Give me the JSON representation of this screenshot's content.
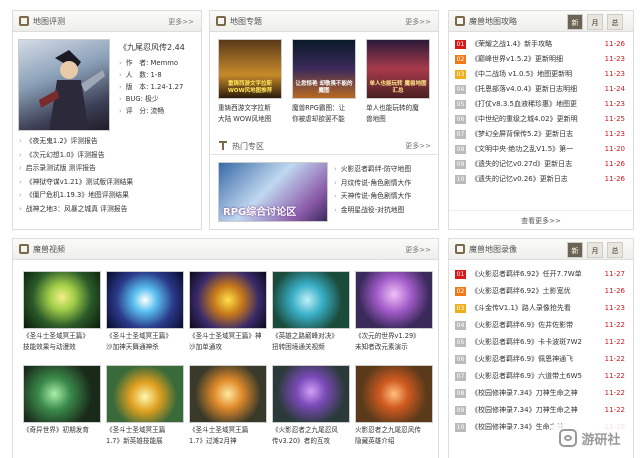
{
  "map_review": {
    "title": "地图评测",
    "more": "更多>>",
    "feature": {
      "name": "《九尾忍风传2.44",
      "rows": [
        "作　者: Memmo",
        "人　数: 1-8",
        "版　本: 1.24-1.27",
        "BUG: 极少",
        "评　分: 流畅"
      ]
    },
    "list": [
      "《夜无鬼1.2》评测报告",
      "《次元幻想1.0》评测报告",
      "启示录测试版 测评报告",
      "《神狱夺谋v1.21》测试版评测结果",
      "《僵尸危机1.19.3》地图评测结果",
      "战神之地3：风暴之城真 评测报告"
    ]
  },
  "map_topics": {
    "title": "地图专题",
    "more": "更多>>",
    "items": [
      {
        "img_text": "重铸西游文字拉斯 WOW风地图推荐",
        "caption": [
          "重铸西游文字拉斯",
          "大陆 WOW风地图"
        ]
      },
      {
        "img_text": "让您惊艳 却敬畏不能的魔图",
        "caption": [
          "魔兽RPG霸图：让",
          "你被虐却欲罢不能"
        ]
      },
      {
        "img_text": "单人也能玩转 魔兽地图汇总",
        "caption": [
          "单人也能玩转的魔",
          "兽地图"
        ]
      }
    ]
  },
  "hot_zone": {
    "title": "热门专区",
    "more": "更多>>",
    "banner": "RPG综合讨论区",
    "list": [
      "火影忍者羁绊-防守地图",
      "月纹传说-角色剧情大作",
      "天神传说-角色剧情大作",
      "金明星战役-对抗地图"
    ]
  },
  "map_ranking": {
    "title": "魔兽地图攻略",
    "tabs": [
      "新",
      "月",
      "总"
    ],
    "more": "查看更多>>",
    "rows": [
      {
        "num": "01",
        "text": "《荣耀之战1.4》新手攻略",
        "date": "11-26"
      },
      {
        "num": "02",
        "text": "《巅峰世界v1.5.2》更新明细",
        "date": "11-23"
      },
      {
        "num": "03",
        "text": "《中二战场 v1.0.5》地图更新明",
        "date": "11-23"
      },
      {
        "num": "04",
        "text": "《托恩部落v4.0.4》更新日志明细",
        "date": "11-24"
      },
      {
        "num": "05",
        "text": "《打仗v8.3.5血液稀珍惠》地图更",
        "date": "11-23"
      },
      {
        "num": "06",
        "text": "《中世纪的重级之城4.02》更新明",
        "date": "11-25"
      },
      {
        "num": "07",
        "text": "《梦幻全屏背保传5.2》更新日志",
        "date": "11-23"
      },
      {
        "num": "08",
        "text": "《文明中央·绝功之乱V1.5》第一",
        "date": "11-20"
      },
      {
        "num": "09",
        "text": "《遗失的记忆v0.27d》更新日志",
        "date": "11-26"
      },
      {
        "num": "10",
        "text": "《遗失的记忆v0.26》更新日志",
        "date": "11-26"
      }
    ]
  },
  "map_video": {
    "title": "魔兽视频",
    "more": "更多>>",
    "row1": [
      {
        "caption": [
          "《圣斗士圣域冥王篇》",
          "技能效果与动漫效"
        ]
      },
      {
        "caption": [
          "《圣斗士圣域冥王篇》",
          "沙加神天舞通神杀"
        ]
      },
      {
        "caption": [
          "《圣斗士圣域冥王篇》神",
          "沙加单通攻"
        ]
      },
      {
        "caption": [
          "《英雄之路巅峰对决》",
          "扭转困境通关视频"
        ]
      },
      {
        "caption": [
          "《次元的世界v1.29》",
          "未知者改元素演示"
        ]
      }
    ],
    "row2": [
      {
        "caption": [
          "《奇异世界》初期发育",
          ""
        ]
      },
      {
        "caption": [
          "《圣斗士圣域冥王篇",
          "1.7》新英雄技能展"
        ]
      },
      {
        "caption": [
          "《圣斗士圣域冥王篇",
          "1.7》过滩2月神"
        ]
      },
      {
        "caption": [
          "《火影忍者之九尾忍风",
          "传v3.20》者的互攻"
        ]
      },
      {
        "caption": [
          "火影忍者之九尾忍风传",
          "隐藏英雄介绍"
        ]
      }
    ]
  },
  "video_ranking": {
    "title": "魔兽地图录像",
    "tabs": [
      "新",
      "月",
      "总"
    ],
    "rows": [
      {
        "num": "01",
        "text": "《火影忍者羁绊6.92》任开7.7W单",
        "date": "11-27"
      },
      {
        "num": "02",
        "text": "《火影忍者羁绊6.92》土影宽优",
        "date": "11-26"
      },
      {
        "num": "03",
        "text": "《斗金传V1.1》路人录像抢先看",
        "date": "11-23"
      },
      {
        "num": "04",
        "text": "《火影忍者羁绊6.9》佐井佐影带",
        "date": "11-22"
      },
      {
        "num": "05",
        "text": "《火影忍者羁绊6.9》卡卡波斑7W2",
        "date": "11-22"
      },
      {
        "num": "06",
        "text": "《火影忍者羁绊6.9》佩恩神通飞",
        "date": "11-22"
      },
      {
        "num": "07",
        "text": "《火影忍者羁绊6.9》六道带土6W5",
        "date": "11-22"
      },
      {
        "num": "08",
        "text": "《校园修神录7.34》刀神生命之神",
        "date": "11-22"
      },
      {
        "num": "09",
        "text": "《校园修神录7.34》刀神生命之神",
        "date": "11-22"
      },
      {
        "num": "10",
        "text": "《校园修神录7.34》生命之神",
        "date": "11-20"
      }
    ]
  },
  "watermark": "游研社"
}
